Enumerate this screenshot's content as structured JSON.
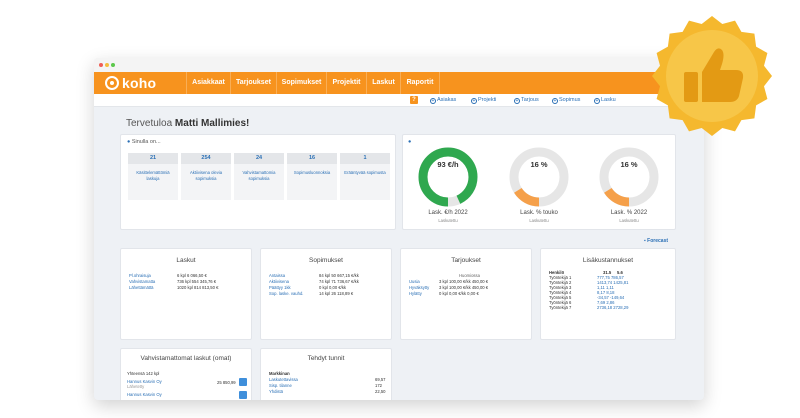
{
  "app": {
    "logo_text": "koho"
  },
  "nav": {
    "items": [
      "Asiakkaat",
      "Tarjoukset",
      "Sopimukset",
      "Projektit",
      "Laskut",
      "Raportit"
    ]
  },
  "subnav": {
    "help": "?",
    "items": [
      "Asiakas",
      "Projekti",
      "Tarjous",
      "Sopimus",
      "Lasku"
    ]
  },
  "welcome": {
    "greeting": "Tervetuloa",
    "name": "Matti Mallimies!"
  },
  "summary": {
    "title": "Sinulla on...",
    "tiles": [
      {
        "value": "21",
        "label": "Käsittelemättömiä laskuja"
      },
      {
        "value": "254",
        "label": "Aktiivisena olevia sopimuksia"
      },
      {
        "value": "24",
        "label": "Vahvistamattomia sopimuksia"
      },
      {
        "value": "16",
        "label": "Sopimusluonnoksia"
      },
      {
        "value": "1",
        "label": "Erääntyvää sopimusta"
      }
    ]
  },
  "gauges": [
    {
      "value_text": "93 €/h",
      "fill": 0.93,
      "color": "#2fa84f",
      "label": "Lask. €/h 2022",
      "sub": "Laskutettu"
    },
    {
      "value_text": "16 %",
      "fill": 0.16,
      "color": "#f5a04a",
      "label": "Lask. % touko",
      "sub": "Laskutettu"
    },
    {
      "value_text": "16 %",
      "fill": 0.16,
      "color": "#f5a04a",
      "label": "Lask. % 2022",
      "sub": "Laskutettu"
    }
  ],
  "forecast_link": "Forecast",
  "laskut": {
    "title": "Laskut",
    "rows": [
      {
        "name": "Pl.ohraisuja",
        "value": "6 kpl  6 066,50 €"
      },
      {
        "name": "Vahvistamatta",
        "value": "736 kpl 554 345,76 €"
      },
      {
        "name": "Lähettämättä",
        "value": "1020 kpl 814 813,50 €"
      }
    ]
  },
  "sopimukset": {
    "title": "Sopimukset",
    "rows": [
      {
        "name": "Antaissa",
        "value": "84 kpl 50 667,15 €/kk"
      },
      {
        "name": "Aktiivisena",
        "value": "74 kpl 71 736,67 €/kk"
      },
      {
        "name": "Päättyy 1kk",
        "value": "0 kpl  0,00 €/kk"
      },
      {
        "name": "Sop. laske. vauhd.",
        "value": "14 kpl  26 118,89 €"
      }
    ]
  },
  "tarjoukset": {
    "title": "Tarjoukset",
    "sub": "Huomiossa",
    "rows": [
      {
        "name": "Uusia",
        "value": "3 kpl 100,00 €/kk 450,00 €"
      },
      {
        "name": "Hyväksytty",
        "value": "3 kpl 100,00 €/kk 450,00 €"
      },
      {
        "name": "Hylätty",
        "value": "0 kpl  0,00 €/kk  0,00 €"
      }
    ]
  },
  "tuntikertymat": {
    "title": "Lisäkustannukset",
    "header": [
      "Henkilö",
      "31.5",
      "5.6"
    ],
    "rows": [
      {
        "name": "Työntekijä 1",
        "values": "777,75  786,57"
      },
      {
        "name": "Työntekijä 2",
        "values": "1413,74 1425,81"
      },
      {
        "name": "Työntekijä 3",
        "values": "1,11   1,11"
      },
      {
        "name": "Työntekijä 4",
        "values": "8,17   8,18"
      },
      {
        "name": "Työntekijä 5",
        "values": "-34,57  -149,64"
      },
      {
        "name": "Työntekijä 6",
        "values": "7,69   2,86"
      },
      {
        "name": "Työntekijä 7",
        "values": "2736,18 2728,29"
      }
    ]
  },
  "unconfirmed": {
    "title": "Vahvistamattomat laskut (omat)",
    "count_line": "Yhteensä 142 kpl",
    "rows": [
      {
        "name": "Hannus Kasvin Oy",
        "sub": "Lähetetty",
        "amount": "25 850,99"
      },
      {
        "name": "Hannus Kasvin Oy",
        "sub": "",
        "amount": ""
      }
    ]
  },
  "hours": {
    "title": "Tehdyt tunnit",
    "section": "Markkinan",
    "rows": [
      {
        "name": "Laskutettavissa",
        "value": "69,57"
      },
      {
        "name": "Sisp. tilanne",
        "value": "172"
      },
      {
        "name": "Yhdistä",
        "value": "22,50"
      }
    ]
  },
  "badge": {
    "icon": "thumbs-up-icon",
    "color": "#f5b82e"
  }
}
